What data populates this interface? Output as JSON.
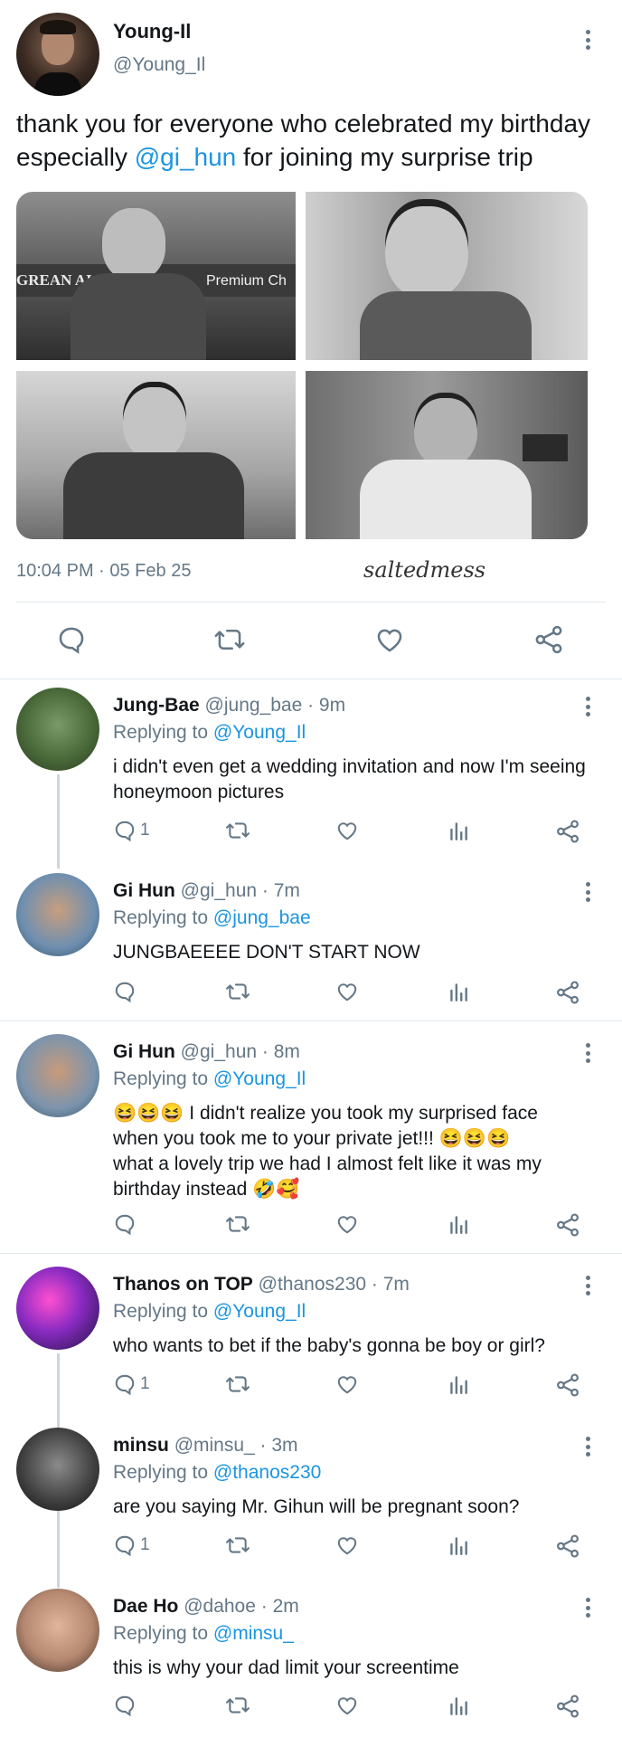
{
  "main_tweet": {
    "display_name": "Young-Il",
    "handle": "@Young_Il",
    "text_before": "thank you for everyone who celebrated my birthday especially ",
    "mention": "@gi_hun",
    "text_after": " for joining my surprise trip",
    "photo1_sign_text": "GREAN AI",
    "photo1_banner": "Premium Ch",
    "timestamp": "10:04 PM · 05 Feb 25",
    "watermark": "saltedmess"
  },
  "icons": [
    "reply-icon",
    "retweet-icon",
    "like-icon",
    "share-icon",
    "analytics-icon",
    "more-icon"
  ],
  "colors": {
    "link": "#1b95e0",
    "muted": "#657786",
    "divider": "#e1e8ed"
  },
  "replies": [
    {
      "name": "Jung-Bae",
      "meta": "@jung_bae · 9m",
      "replying_label": "Replying to",
      "replying_to": "@Young_Il",
      "text": "i didn't even get a wedding invitation and now I'm seeing honeymoon pictures",
      "reply_count": "1"
    },
    {
      "name": "Gi Hun",
      "meta": "@gi_hun · 7m",
      "replying_label": "Replying to",
      "replying_to": "@jung_bae",
      "text": "JUNGBAEEEE DON'T START NOW",
      "reply_count": ""
    },
    {
      "name": "Gi Hun",
      "meta": "@gi_hun · 8m",
      "replying_label": "Replying to",
      "replying_to": "@Young_Il",
      "text_line1": "😆😆😆 I didn't realize you took my surprised face",
      "text_line2": "when you took me to your private jet!!! 😆😆😆",
      "text_line3": "what a lovely trip we had I almost felt like it was my",
      "text_line4": "birthday instead 🤣🥰",
      "reply_count": ""
    },
    {
      "name": "Thanos on TOP",
      "meta": "@thanos230 · 7m",
      "replying_label": "Replying to",
      "replying_to": "@Young_Il",
      "text": "who wants to bet if the baby's gonna be boy or girl?",
      "reply_count": "1"
    },
    {
      "name": "minsu",
      "meta": "@minsu_ · 3m",
      "replying_label": "Replying to",
      "replying_to": "@thanos230",
      "text": "are you saying Mr. Gihun will be pregnant soon?",
      "reply_count": "1"
    },
    {
      "name": "Dae Ho",
      "meta": "@dahoe · 2m",
      "replying_label": "Replying to",
      "replying_to": "@minsu_",
      "text": "this is why your dad limit your screentime",
      "reply_count": ""
    }
  ]
}
